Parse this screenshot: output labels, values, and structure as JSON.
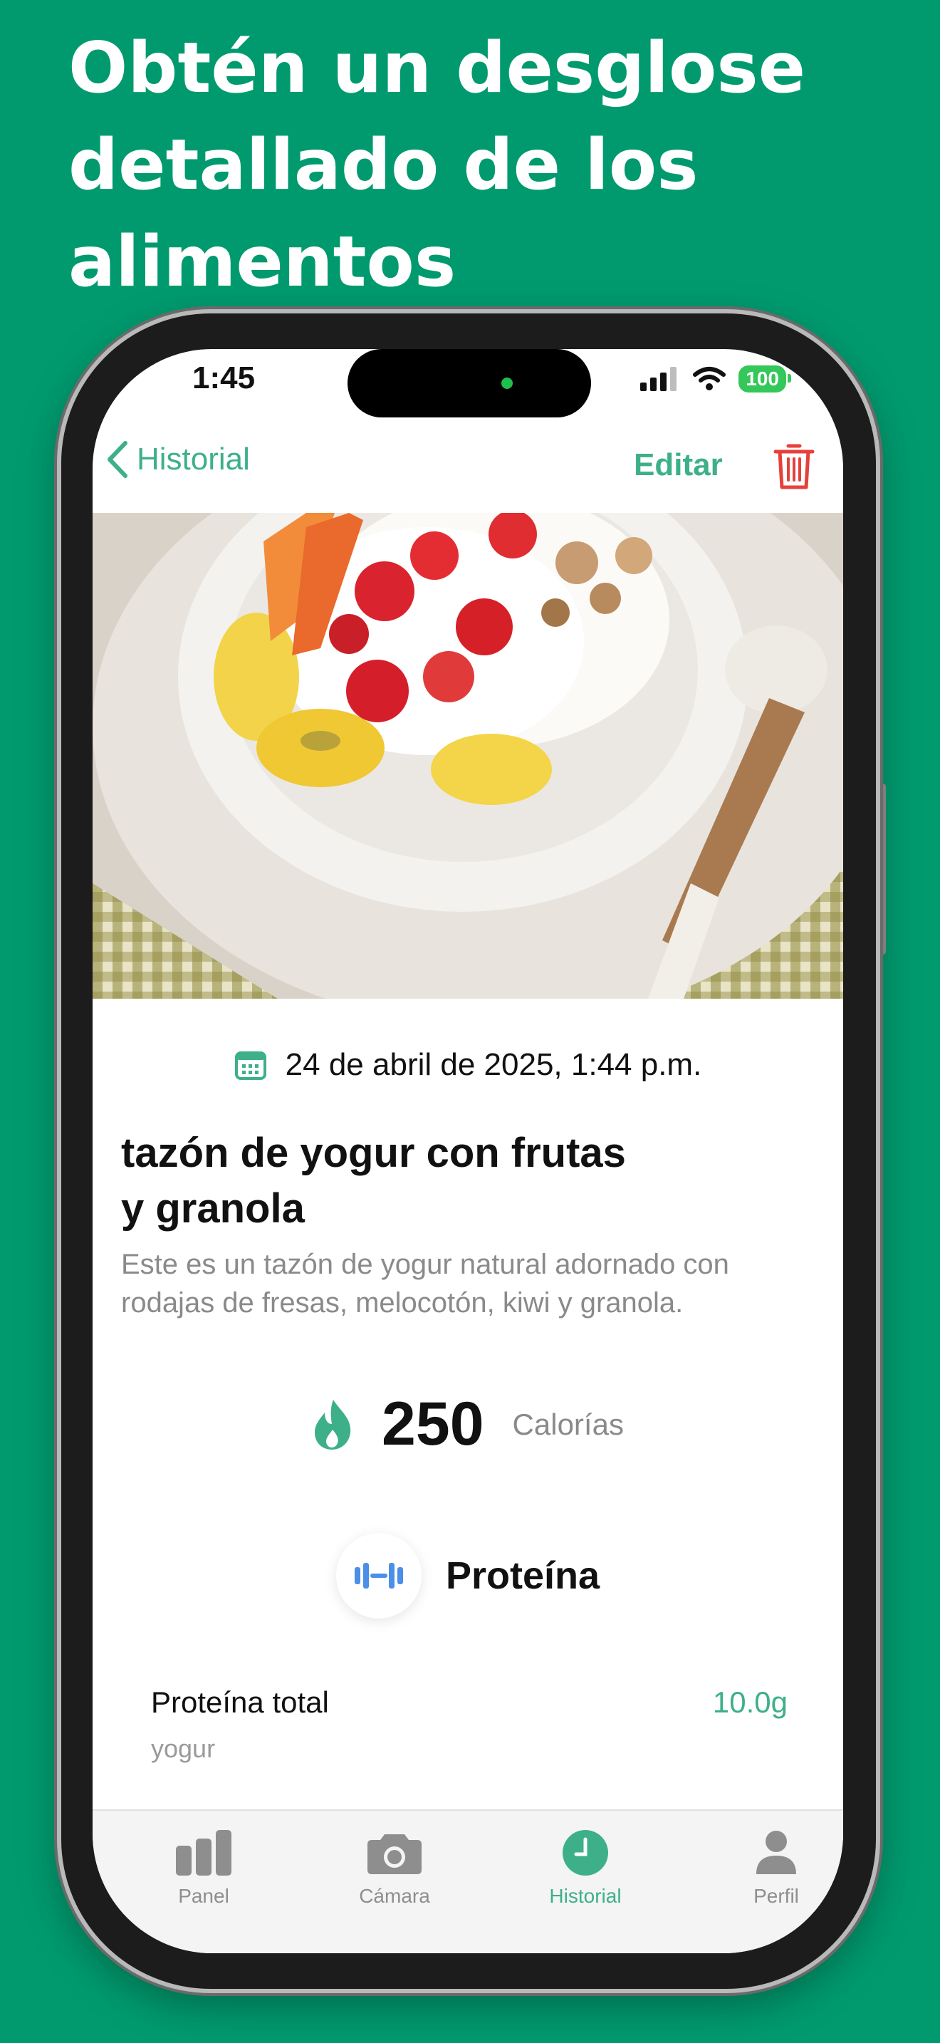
{
  "headline": "Obtén un desglose detallado de los alimentos",
  "status": {
    "time": "1:45",
    "battery": "100"
  },
  "nav": {
    "back_label": "Historial",
    "edit_label": "Editar"
  },
  "meal": {
    "date": "24 de abril de 2025, 1:44 p.m.",
    "title_line1": "tazón de yogur con frutas",
    "title_line2": "y granola",
    "description": "Este es un tazón de yogur natural adornado con rodajas de fresas, melocotón, kiwi y granola.",
    "calories_value": "250",
    "calories_label": "Calorías"
  },
  "protein": {
    "heading": "Proteína",
    "total_label": "Proteína total",
    "total_value": "10.0g",
    "source": "yogur"
  },
  "tabs": [
    {
      "label": "Panel",
      "icon": "bar-chart-icon"
    },
    {
      "label": "Cámara",
      "icon": "camera-icon"
    },
    {
      "label": "Historial",
      "icon": "clock-icon"
    },
    {
      "label": "Perfil",
      "icon": "person-icon"
    }
  ],
  "colors": {
    "background": "#009a6e",
    "accent": "#3db08a",
    "delete": "#e5413b",
    "protein_icon": "#4a8fe8"
  }
}
